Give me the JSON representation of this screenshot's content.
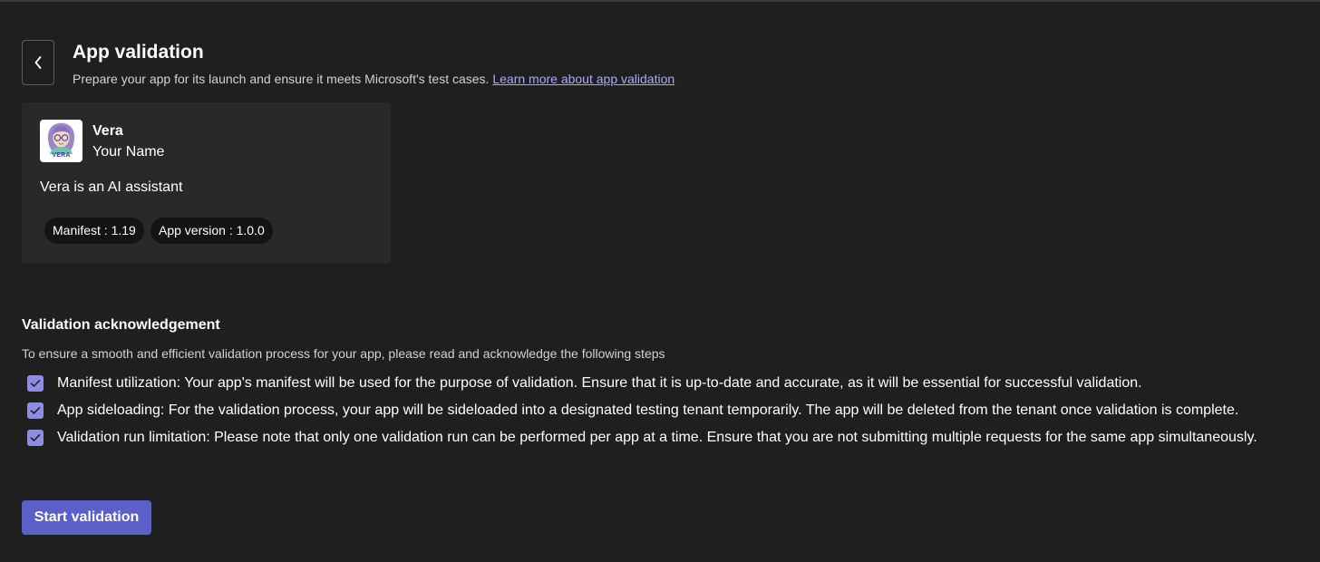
{
  "header": {
    "title": "App validation",
    "subtitle": "Prepare your app for its launch and ensure it meets Microsoft's test cases.",
    "learn_more_link": "Learn more about app validation",
    "back_icon": "chevron-left-icon"
  },
  "app_card": {
    "icon_label": "VERA",
    "name": "Vera",
    "developer": "Your Name",
    "description": "Vera is an AI assistant",
    "manifest_chip": "Manifest : 1.19",
    "version_chip": "App version : 1.0.0"
  },
  "acknowledgement": {
    "title": "Validation acknowledgement",
    "description": "To ensure a smooth and efficient validation process for your app, please read and acknowledge the following steps",
    "items": [
      {
        "text": "Manifest utilization: Your app's manifest will be used for the purpose of validation. Ensure that it is up-to-date and accurate, as it will be essential for successful validation.",
        "checked": true
      },
      {
        "text": "App sideloading: For the validation process, your app will be sideloaded into a designated testing tenant temporarily. The app will be deleted from the tenant once validation is complete.",
        "checked": true
      },
      {
        "text": "Validation run limitation: Please note that only one validation run can be performed per app at a time. Ensure that you are not submitting multiple requests for the same app simultaneously.",
        "checked": true
      }
    ]
  },
  "actions": {
    "start_label": "Start validation"
  },
  "colors": {
    "background": "#1f1f1f",
    "card": "#292929",
    "accent": "#5b5fc7",
    "checkbox": "#8e8de6",
    "link": "#a9a9ff"
  }
}
